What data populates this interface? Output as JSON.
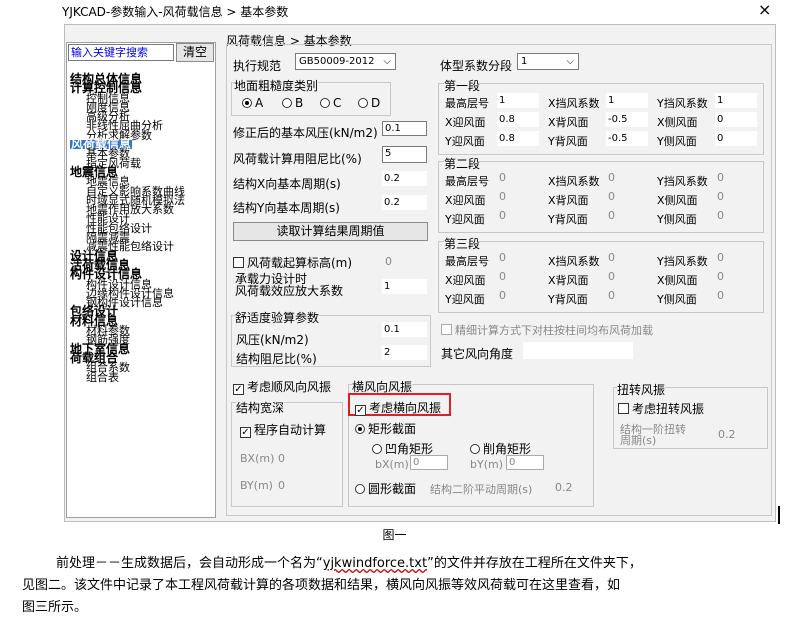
{
  "window": {
    "title": "YJKCAD-参数输入-风荷载信息 > 基本参数",
    "close": "×"
  },
  "left": {
    "search_placeholder": "输入关键字搜索",
    "clear": "清空",
    "tree": [
      {
        "t": "结构总体信息",
        "b": true
      },
      {
        "t": "计算控制信息",
        "b": true
      },
      {
        "t": "控制信息"
      },
      {
        "t": "刚度信息"
      },
      {
        "t": "高级分析"
      },
      {
        "t": "非线性屈曲分析"
      },
      {
        "t": "分析求解参数"
      },
      {
        "t": "风荷载信息",
        "b": true,
        "sel": true
      },
      {
        "t": "基本参数"
      },
      {
        "t": "指定风荷载"
      },
      {
        "t": "地震信息",
        "b": true
      },
      {
        "t": "地震信息"
      },
      {
        "t": "自定义影响系数曲线"
      },
      {
        "t": "时域显式随机模拟法"
      },
      {
        "t": "地震作用放大系数"
      },
      {
        "t": "性能设计"
      },
      {
        "t": "性能包络设计"
      },
      {
        "t": "隔震减震"
      },
      {
        "t": "减震性能包络设计"
      },
      {
        "t": "设计信息",
        "b": true
      },
      {
        "t": "活荷载信息",
        "b": true
      },
      {
        "t": "构件设计信息",
        "b": true
      },
      {
        "t": "构件设计信息"
      },
      {
        "t": "边缘构件设计信息"
      },
      {
        "t": "钢构件设计信息"
      },
      {
        "t": "包络设计",
        "b": true
      },
      {
        "t": "材料信息",
        "b": true
      },
      {
        "t": "材料参数"
      },
      {
        "t": "钢筋强度"
      },
      {
        "t": "地下室信息",
        "b": true
      },
      {
        "t": "荷载组合",
        "b": true
      },
      {
        "t": "组合系数"
      },
      {
        "t": "组合表"
      }
    ]
  },
  "right": {
    "breadcrumb": "风荷载信息 > 基本参数",
    "code_label": "执行规范",
    "code_value": "GB50009-2012",
    "shape_seg_label": "体型系数分段",
    "shape_seg_value": "1",
    "roughness_label": "地面粗糙度类别",
    "roughness": [
      "A",
      "B",
      "C",
      "D"
    ],
    "base_pressure_label": "修正后的基本风压(kN/m2)",
    "base_pressure": "0.1",
    "damping_label": "风荷载计算用阻尼比(%)",
    "damping": "5",
    "tx_label": "结构X向基本周期(s)",
    "tx": "0.2",
    "ty_label": "结构Y向基本周期(s)",
    "ty": "0.2",
    "read_period_btn": "读取计算结果周期值",
    "start_height_label": "风荷载起算标高(m)",
    "start_height": "0",
    "amp_label1": "承载力设计时",
    "amp_label2": "风荷载效应放大系数",
    "amp": "1",
    "comfort_title": "舒适度验算参数",
    "comfort_pressure_label": "风压(kN/m2)",
    "comfort_pressure": "0.1",
    "comfort_damping_label": "结构阻尼比(%)",
    "comfort_damping": "2",
    "seg1": {
      "title": "第一段",
      "top_floor_label": "最高层号",
      "top_floor": "1",
      "x_shape_label": "X挡风系数",
      "x_shape": "1",
      "y_shape_label": "Y挡风系数",
      "y_shape": "1",
      "xw_label": "X迎风面",
      "xw": "0.8",
      "xl_label": "X背风面",
      "xl": "-0.5",
      "xs_label": "X侧风面",
      "xs": "0",
      "yw_label": "Y迎风面",
      "yw": "0.8",
      "yl_label": "Y背风面",
      "yl": "-0.5",
      "ys_label": "Y侧风面",
      "ys": "0"
    },
    "seg2": {
      "title": "第二段",
      "top_floor_label": "最高层号",
      "top_floor": "0",
      "x_shape_label": "X挡风系数",
      "x_shape": "0",
      "y_shape_label": "Y挡风系数",
      "y_shape": "0",
      "xw_label": "X迎风面",
      "xw": "0",
      "xl_label": "X背风面",
      "xl": "0",
      "xs_label": "X侧风面",
      "xs": "0",
      "yw_label": "Y迎风面",
      "yw": "0",
      "yl_label": "Y背风面",
      "yl": "0",
      "ys_label": "Y侧风面",
      "ys": "0"
    },
    "seg3": {
      "title": "第三段",
      "top_floor_label": "最高层号",
      "top_floor": "0",
      "x_shape_label": "X挡风系数",
      "x_shape": "0",
      "y_shape_label": "Y挡风系数",
      "y_shape": "0",
      "xw_label": "X迎风面",
      "xw": "0",
      "xl_label": "X背风面",
      "xl": "0",
      "xs_label": "X侧风面",
      "xs": "0",
      "yw_label": "Y迎风面",
      "yw": "0",
      "yl_label": "Y背风面",
      "yl": "0",
      "ys_label": "Y侧风面",
      "ys": "0"
    },
    "fine_calc_label": "精细计算方式下对柱按柱间均布风荷加载",
    "other_angle_label": "其它风向角度",
    "along_wind_label": "考虑顺风向风振",
    "width_title": "结构宽深",
    "auto_calc_label": "程序自动计算",
    "bx_label": "BX(m)",
    "bx": "0",
    "by_label": "BY(m)",
    "by": "0",
    "cross_title": "横风向风振",
    "cross_label": "考虑横向风振",
    "rect_label": "矩形截面",
    "concave_label": "凹角矩形",
    "chamfer_label": "削角矩形",
    "bxm_label": "bX(m)",
    "bxm": "0",
    "bym_label": "bY(m)",
    "bym": "0",
    "circle_label": "圆形截面",
    "second_period_label": "结构二阶平动周期(s)",
    "second_period": "0.2",
    "torsion_title": "扭转风振",
    "torsion_label": "考虑扭转风振",
    "torsion_period_label1": "结构一阶扭转",
    "torsion_period_label2": "周期(s)",
    "torsion_period": "0.2"
  },
  "doc": {
    "caption": "图一",
    "p1_a": "前处理－－生成数据后，会自动形成一个名为“",
    "p1_file": "yjkwindforce.txt",
    "p1_b": "”的文件并存放在工程所在文件夹下，",
    "p2": "见图二。该文件中记录了本工程风荷载计算的各项数据和结果，横风向风振等效风荷载可在这里查看，如",
    "p3": "图三所示。"
  }
}
